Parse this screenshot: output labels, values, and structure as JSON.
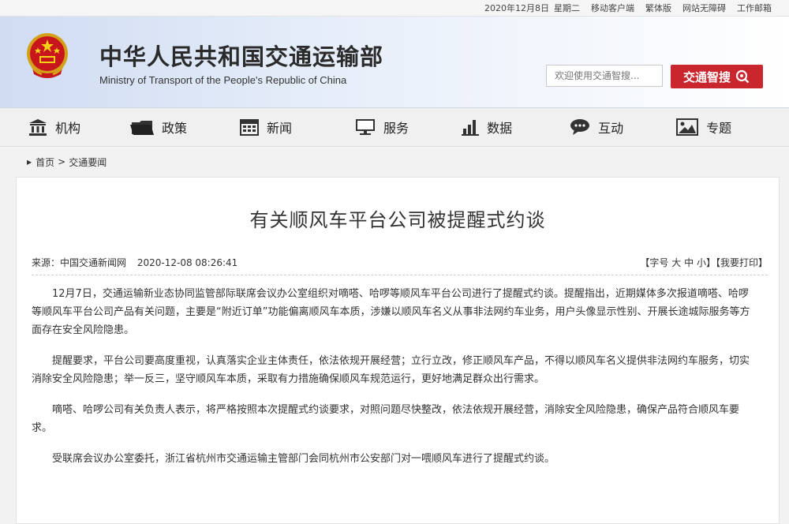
{
  "topbar": {
    "date": "2020年12月8日",
    "weekday": "星期二",
    "links": [
      "移动客户端",
      "繁体版",
      "网站无障碍",
      "工作邮箱"
    ]
  },
  "header": {
    "title_cn": "中华人民共和国交通运输部",
    "title_en": "Ministry of Transport of the People's Republic of China",
    "search_placeholder": "欢迎使用交通智搜...",
    "search_button": "交通智搜",
    "accent_color": "#c9262d"
  },
  "nav": {
    "items": [
      {
        "label": "机构",
        "icon": "building-icon"
      },
      {
        "label": "政策",
        "icon": "folder-icon"
      },
      {
        "label": "新闻",
        "icon": "calendar-icon"
      },
      {
        "label": "服务",
        "icon": "monitor-icon"
      },
      {
        "label": "数据",
        "icon": "bar-chart-icon"
      },
      {
        "label": "互动",
        "icon": "chat-icon"
      },
      {
        "label": "专题",
        "icon": "picture-icon"
      }
    ]
  },
  "breadcrumb": {
    "home": "首页",
    "separator": ">",
    "current": "交通要闻"
  },
  "article": {
    "title": "有关顺风车平台公司被提醒式约谈",
    "source": "来源：中国交通新闻网",
    "datetime": "2020-12-08 08:26:41",
    "font_size_label": "【字号",
    "font_large": "大",
    "font_medium": "中",
    "font_small": "小",
    "font_close": "】",
    "print_label": "【我要打印】",
    "paragraphs": [
      "12月7日，交通运输新业态协同监管部际联席会议办公室组织对嘀嗒、哈啰等顺风车平台公司进行了提醒式约谈。提醒指出，近期媒体多次报道嘀嗒、哈啰等顺风车平台公司产品有关问题，主要是“附近订单”功能偏离顺风车本质，涉嫌以顺风车名义从事非法网约车业务，用户头像显示性别、开展长途城际服务等方面存在安全风险隐患。",
      "提醒要求，平台公司要高度重视，认真落实企业主体责任，依法依规开展经营；立行立改，修正顺风车产品，不得以顺风车名义提供非法网约车服务，切实消除安全风险隐患；举一反三，坚守顺风车本质，采取有力措施确保顺风车规范运行，更好地满足群众出行需求。",
      "嘀嗒、哈啰公司有关负责人表示，将严格按照本次提醒式约谈要求，对照问题尽快整改，依法依规开展经营，消除安全风险隐患，确保产品符合顺风车要求。",
      "受联席会议办公室委托，浙江省杭州市交通运输主管部门会同杭州市公安部门对一喂顺风车进行了提醒式约谈。"
    ]
  }
}
